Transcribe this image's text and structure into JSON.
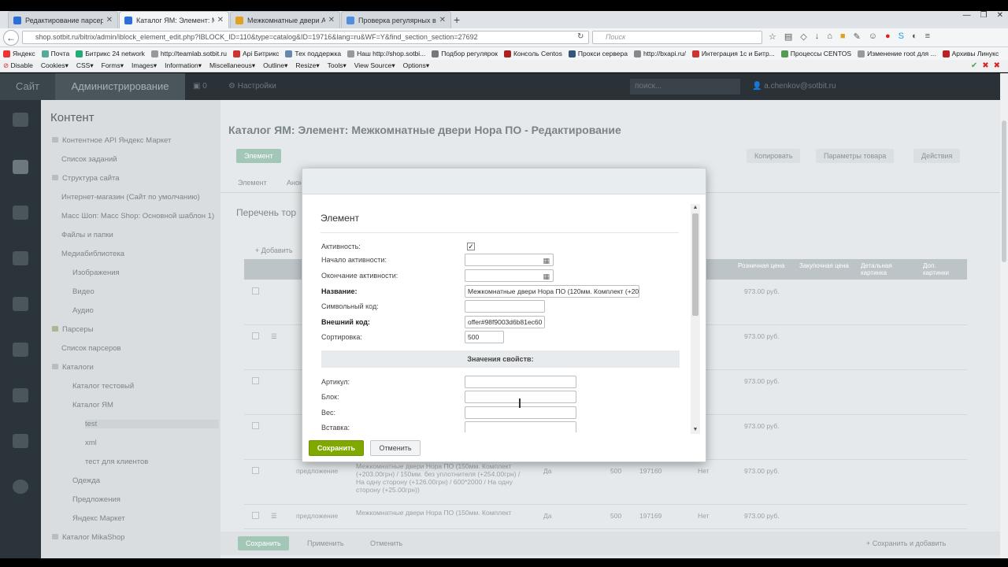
{
  "browser": {
    "tabs": [
      {
        "title": "Редактирование парсера -",
        "color": "#2a6fdb"
      },
      {
        "title": "Каталог ЯМ: Элемент: М...",
        "color": "#2a6fdb"
      },
      {
        "title": "Межкомнатные двери Ar...",
        "color": "#e0a020"
      },
      {
        "title": "Проверка регулярных в...",
        "color": "#4f8fe0"
      }
    ],
    "url": "shop.sotbit.ru/bitrix/admin/iblock_element_edit.php?IBLOCK_ID=110&type=catalog&ID=19716&lang=ru&WF=Y&find_section_section=27692",
    "search_placeholder": "Поиск",
    "bookmarks": [
      "Яндекс",
      "Почта",
      "Битрикс 24 network",
      "http://teamlab.sotbit.ru",
      "Api Битрикс",
      "Тех поддержка",
      "Наш http://shop.sotbi...",
      "Подбор регулярок",
      "Консоль Centos",
      "Прокси сервера",
      "http://bxapi.ru/",
      "Интеграция 1с и Битр...",
      "Процессы CENTOS",
      "Изменение root для ...",
      "Архивы Линукс"
    ],
    "devbar": [
      "Disable",
      "Cookies",
      "CSS",
      "Forms",
      "Images",
      "Information",
      "Miscellaneous",
      "Outline",
      "Resize",
      "Tools",
      "View Source",
      "Options"
    ]
  },
  "admin": {
    "site_tab": "Сайт",
    "admin_tab": "Администрирование",
    "settings_label": "Настройки",
    "search_label": "поиск...",
    "user_label": "a.chenkov@sotbit.ru",
    "content_head": "Контент",
    "tree_items": [
      "Контентное API Яндекс Маркет",
      "Список заданий",
      "Структура сайта",
      "Интернет-магазин (Сайт по умолчанию)",
      "Масс Шоп: Масс Shop: Основной шаблон 1)",
      "Файлы и папки",
      "Медиабиблиотека",
      "Изображения",
      "Видео",
      "Аудио",
      "Парсеры",
      "Список парсеров",
      "Каталоги",
      "Каталог тестовый",
      "Каталог ЯМ",
      "test",
      "xml",
      "тест для клиентов",
      "Одежда",
      "Предложения",
      "Яндекс Маркет",
      "Каталог MikaShop"
    ],
    "page_title": "Каталог ЯМ: Элемент: Межкомнатные двери Нора ПО - Редактирование",
    "btn_save": "Элемент",
    "btn_copy": "Копировать",
    "btn_params": "Параметры товара",
    "btn_actions": "Действия",
    "tabs": [
      "Элемент",
      "Анонс"
    ],
    "list_title": "Перечень тор",
    "add_label": "Добавить",
    "table_headers": [
      "Розничная цена",
      "Закупочная цена",
      "Детальная картинка",
      "Доп. картинки"
    ],
    "rows": [
      {
        "type": "",
        "name": "",
        "active": "",
        "sort": "",
        "id": "",
        "nom": "",
        "price": "973.00 руб."
      },
      {
        "type": "",
        "name": "",
        "active": "",
        "sort": "",
        "id": "",
        "nom": "",
        "price": "973.00 руб."
      },
      {
        "type": "",
        "name": "",
        "active": "",
        "sort": "",
        "id": "",
        "nom": "",
        "price": "973.00 руб."
      },
      {
        "type": "",
        "name": "",
        "active": "",
        "sort": "",
        "id": "",
        "nom": "",
        "price": "973.00 руб."
      },
      {
        "type": "предложение",
        "name": "Межкомнатные двери Нора ПО (150мм. Комплект (+203.00грн) / 150мм. без уплотнителя (+254.00грн) / На одну сторону (+126.00грн) / 600*2000 / На одну сторону (+25.00грн))",
        "active": "Да",
        "sort": "500",
        "id": "197160",
        "nom": "Нет",
        "price": "973.00 руб."
      },
      {
        "type": "предложение",
        "name": "Межкомнатные двери Нора ПО (150мм. Комплект",
        "active": "Да",
        "sort": "500",
        "id": "197169",
        "nom": "Нет",
        "price": "973.00 руб."
      }
    ],
    "bottom_save": "Сохранить",
    "bottom_apply": "Применить",
    "bottom_cancel": "Отменить",
    "bottom_right": "Сохранить и добавить"
  },
  "modal": {
    "section_title": "Элемент",
    "active_label": "Активность:",
    "start_label": "Начало активности:",
    "end_label": "Окончание активности:",
    "name_label": "Название:",
    "name_value": "Межкомнатные двери Нора ПО (120мм. Комплект (+20",
    "code_label": "Символьный код:",
    "code_value": "",
    "ext_label": "Внешний код:",
    "ext_value": "offer#98f9003d6b81ec60",
    "sort_label": "Сортировка:",
    "sort_value": "500",
    "props_title": "Значения свойств:",
    "prop_article": "Артикул:",
    "prop_block": "Блок:",
    "prop_weight": "Вес:",
    "prop_insert": "Вставка:",
    "save": "Сохранить",
    "cancel": "Отменить"
  }
}
